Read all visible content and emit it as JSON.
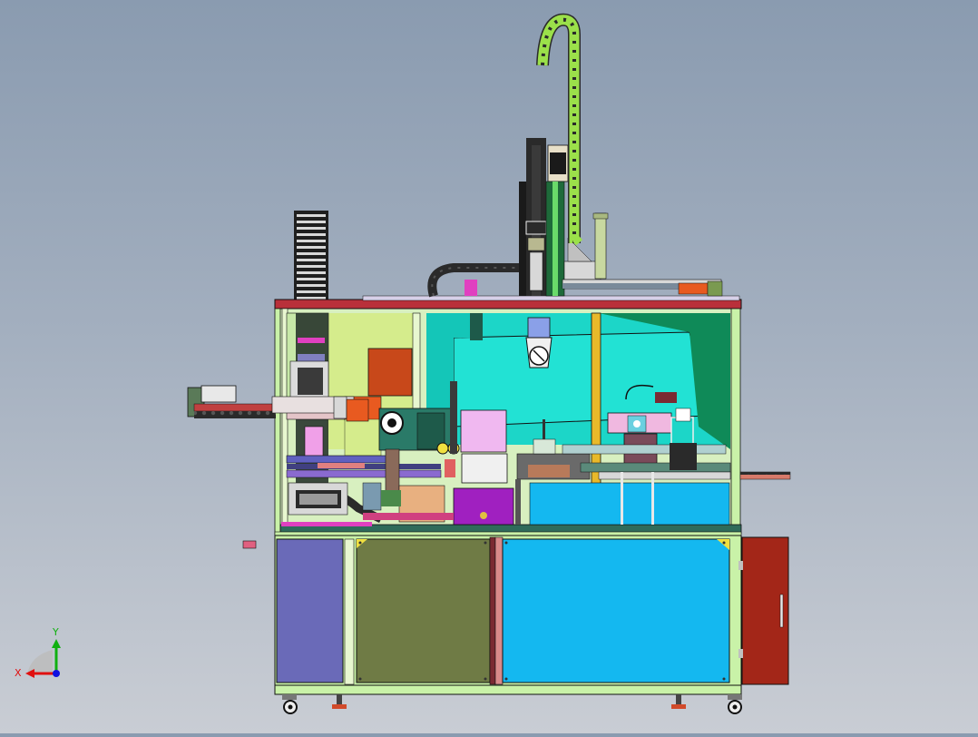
{
  "viewport": {
    "background_top": "#8a9bb0",
    "background_bottom": "#c9cdd4"
  },
  "triad": {
    "x_label": "X",
    "y_label": "Y",
    "x_color": "#e01010",
    "y_color": "#10b010",
    "z_color": "#1010e0"
  },
  "palette": {
    "frame_green": "#c9f2a8",
    "top_plate": "#b9303a",
    "cyan_panel": "#1cd6c8",
    "blue_panel": "#14b8f0",
    "olive_panel": "#6f7b45",
    "violet_panel": "#6a6ab8",
    "door_red": "#a32618",
    "drag_chain": "#9be04a",
    "yellow_post": "#e8b92a",
    "magenta": "#a020c0",
    "orange_block": "#c8481a"
  }
}
